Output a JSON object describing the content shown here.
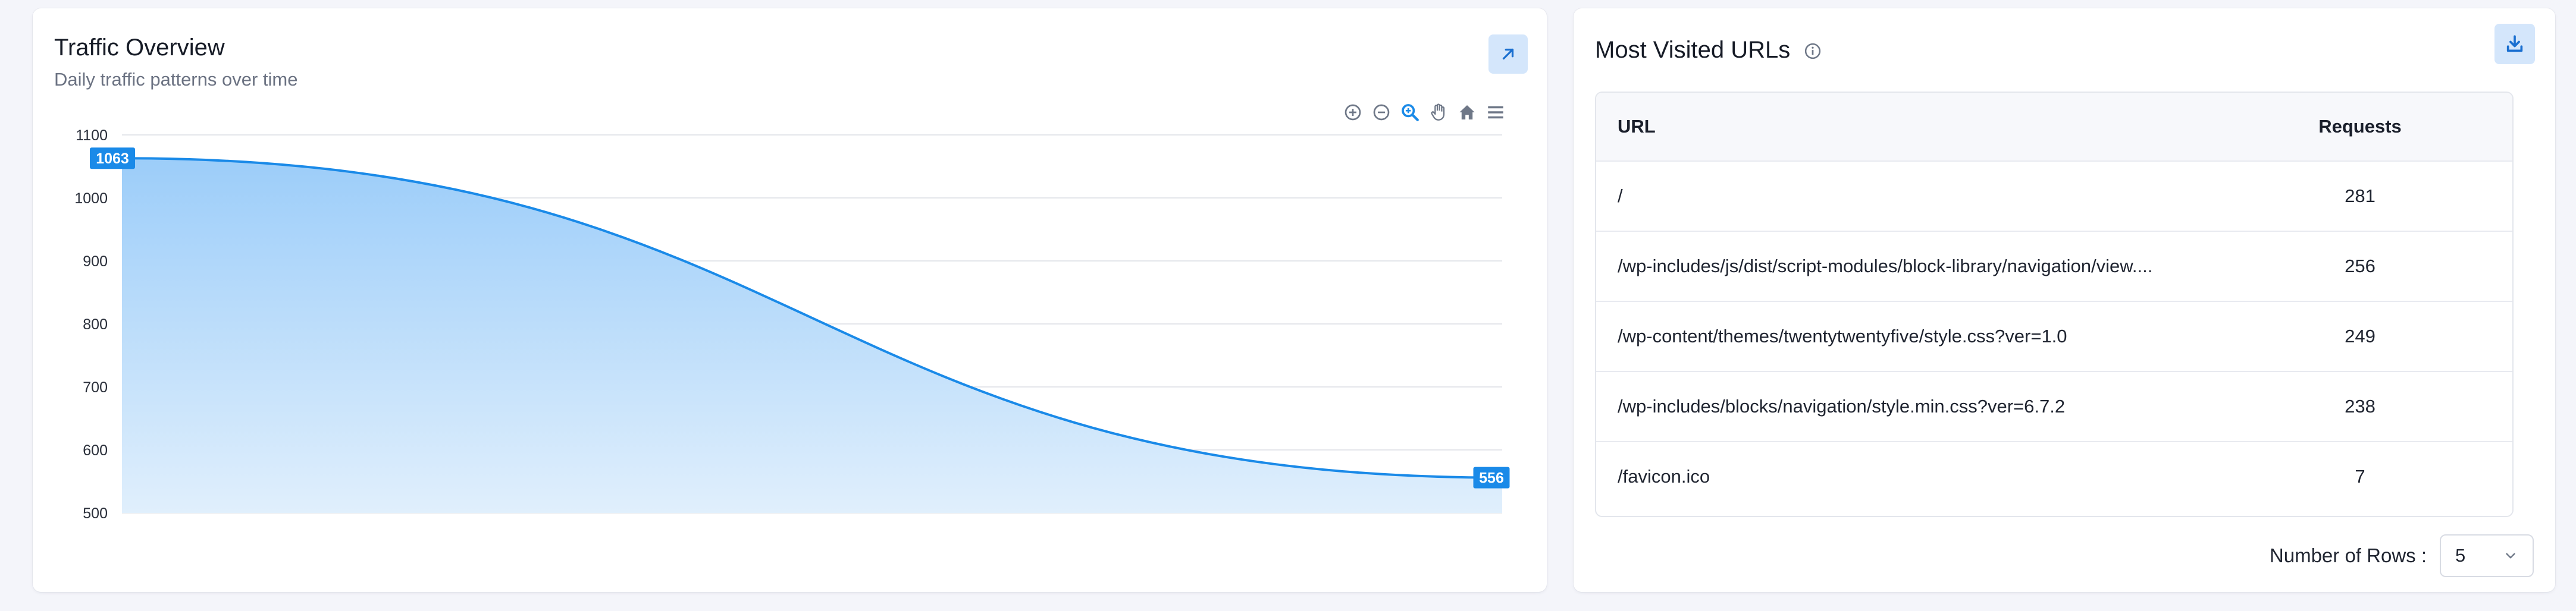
{
  "traffic": {
    "title": "Traffic Overview",
    "subtitle": "Daily traffic patterns over time",
    "toolbar": [
      "zoom-in",
      "zoom-out",
      "selection-zoom",
      "pan",
      "reset",
      "menu"
    ]
  },
  "chart_data": {
    "type": "area",
    "values": [
      1063,
      556
    ],
    "ylim": [
      500,
      1100
    ],
    "yticks": [
      "1100",
      "1000",
      "900",
      "800",
      "700",
      "600",
      "500"
    ],
    "data_labels": [
      "1063",
      "556"
    ],
    "grid": true,
    "colors": {
      "line": "#1a8ae8",
      "fill_top": "#9ccdf9",
      "fill_bottom": "#e0effc"
    }
  },
  "urls": {
    "title": "Most Visited URLs",
    "columns": {
      "url": "URL",
      "requests": "Requests"
    },
    "rows": [
      {
        "url": "/",
        "requests": "281"
      },
      {
        "url": "/wp-includes/js/dist/script-modules/block-library/navigation/view....",
        "requests": "256"
      },
      {
        "url": "/wp-content/themes/twentytwentyfive/style.css?ver=1.0",
        "requests": "249"
      },
      {
        "url": "/wp-includes/blocks/navigation/style.min.css?ver=6.7.2",
        "requests": "238"
      },
      {
        "url": "/favicon.ico",
        "requests": "7"
      }
    ],
    "rows_label": "Number of Rows :",
    "rows_value": "5"
  },
  "colors": {
    "accent": "#1a8ae8",
    "button_bg": "#d4e6fb"
  }
}
